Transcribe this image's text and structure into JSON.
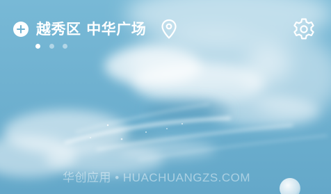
{
  "header": {
    "add_icon": "plus-circle-icon",
    "location": "越秀区 中华广场",
    "location_icon": "map-pin-icon",
    "settings_icon": "gear-icon"
  },
  "pager": {
    "count": 3,
    "active_index": 0
  },
  "watermark": "华创应用 • HUACHUANGZS.COM",
  "colors": {
    "sky": "#6fb1d0",
    "text": "#ffffff"
  }
}
